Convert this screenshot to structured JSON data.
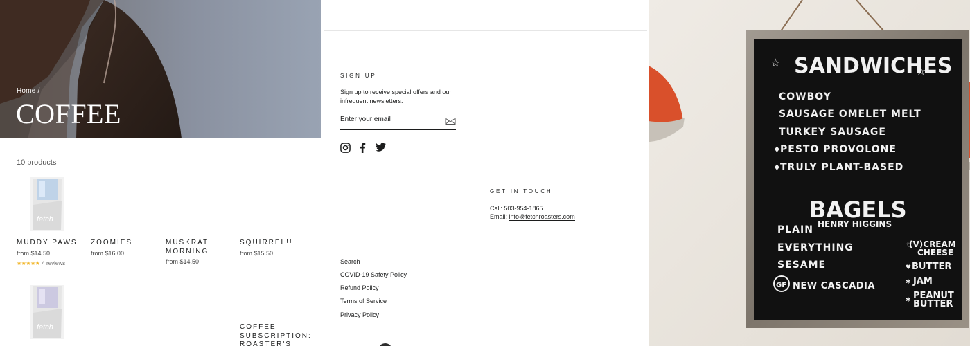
{
  "collection": {
    "breadcrumb": {
      "home": "Home",
      "separator": "/"
    },
    "title": "COFFEE",
    "product_count": "10 products",
    "products": [
      {
        "name": "MUDDY PAWS",
        "price": "from $14.50",
        "stars": "★★★★★",
        "reviews": "4 reviews",
        "brand_mark": "fetch",
        "accent": "#9fc3ea"
      },
      {
        "name": "ZOOMIES",
        "price": "from $16.00"
      },
      {
        "name": "MUSKRAT MORNING",
        "price": "from $14.50"
      },
      {
        "name": "SQUIRREL!!",
        "price": "from $15.50"
      },
      {
        "brand_mark": "fetch",
        "accent": "#b7b1dc"
      },
      {
        "name": "COFFEE SUBSCRIPTION: ROASTER'S"
      }
    ]
  },
  "footer": {
    "signup": {
      "heading": "SIGN UP",
      "text": "Sign up to receive special offers and our infrequent newsletters.",
      "placeholder": "Enter your email",
      "submit_icon": "mail-icon"
    },
    "social": [
      "instagram-icon",
      "facebook-icon",
      "twitter-icon"
    ],
    "contact": {
      "heading": "GET IN TOUCH",
      "call": "Call: 503-954-1865",
      "email_label": "Email: ",
      "email": "info@fetchroasters.com"
    },
    "links": [
      "Search",
      "COVID-19 Safety Policy",
      "Refund Policy",
      "Terms of Service",
      "Privacy Policy"
    ]
  },
  "menu_board": {
    "title": "SANDWICHES",
    "sandwiches": [
      "COWBOY",
      "SAUSAGE OMELET MELT",
      "TURKEY SAUSAGE",
      "PESTO PROVOLONE",
      "TRULY PLANT-BASED"
    ],
    "bagels_title": "BAGELS",
    "bagels_subtitle": "HENRY HIGGINS",
    "bagels": [
      "PLAIN",
      "EVERYTHING",
      "SESAME",
      "NEW CASCADIA"
    ],
    "toppings": [
      "(V)CREAM",
      "CHEESE",
      "BUTTER",
      "JAM",
      "PEANUT",
      "BUTTER"
    ],
    "gf_badge": "GF"
  },
  "colors": {
    "text": "#1c1d1d",
    "star": "#f1b62a",
    "board": "#111111",
    "lamp": "#d9502b"
  }
}
